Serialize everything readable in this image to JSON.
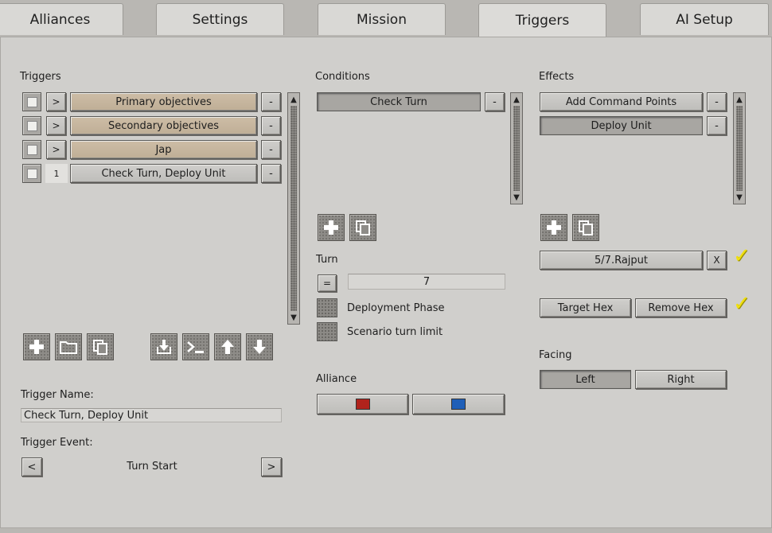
{
  "tabs": [
    {
      "label": "Alliances",
      "active": false
    },
    {
      "label": "Settings",
      "active": false
    },
    {
      "label": "Mission",
      "active": false
    },
    {
      "label": "Triggers",
      "active": true
    },
    {
      "label": "AI Setup",
      "active": false
    }
  ],
  "triggers": {
    "header": "Triggers",
    "items": [
      {
        "expander": ">",
        "label": "Primary objectives",
        "remove": "-"
      },
      {
        "expander": ">",
        "label": "Secondary objectives",
        "remove": "-"
      },
      {
        "expander": ">",
        "label": "Jap",
        "remove": "-"
      },
      {
        "expander": "1",
        "label": "Check Turn, Deploy Unit",
        "remove": "-"
      }
    ],
    "name_label": "Trigger Name:",
    "name_value": "Check Turn, Deploy Unit",
    "event_label": "Trigger Event:",
    "event_prev": "<",
    "event_value": "Turn Start",
    "event_next": ">"
  },
  "conditions": {
    "header": "Conditions",
    "items": [
      {
        "label": "Check Turn",
        "remove": "-"
      }
    ],
    "turn_label": "Turn",
    "turn_operator": "=",
    "turn_value": "7",
    "deployment_phase": "Deployment Phase",
    "scenario_turn_limit": "Scenario turn limit",
    "alliance_label": "Alliance",
    "alliance_colors": [
      "#b0231c",
      "#1f5fb8"
    ]
  },
  "effects": {
    "header": "Effects",
    "items": [
      {
        "label": "Add Command Points",
        "remove": "-"
      },
      {
        "label": "Deploy Unit",
        "remove": "-"
      }
    ],
    "unit_value": "5/7.Rajput",
    "unit_clear": "X",
    "target_hex": "Target Hex",
    "remove_hex": "Remove Hex",
    "facing_label": "Facing",
    "facing_left": "Left",
    "facing_right": "Right",
    "check_mark": "✓"
  },
  "scroll_up": "▲",
  "scroll_down": "▼"
}
